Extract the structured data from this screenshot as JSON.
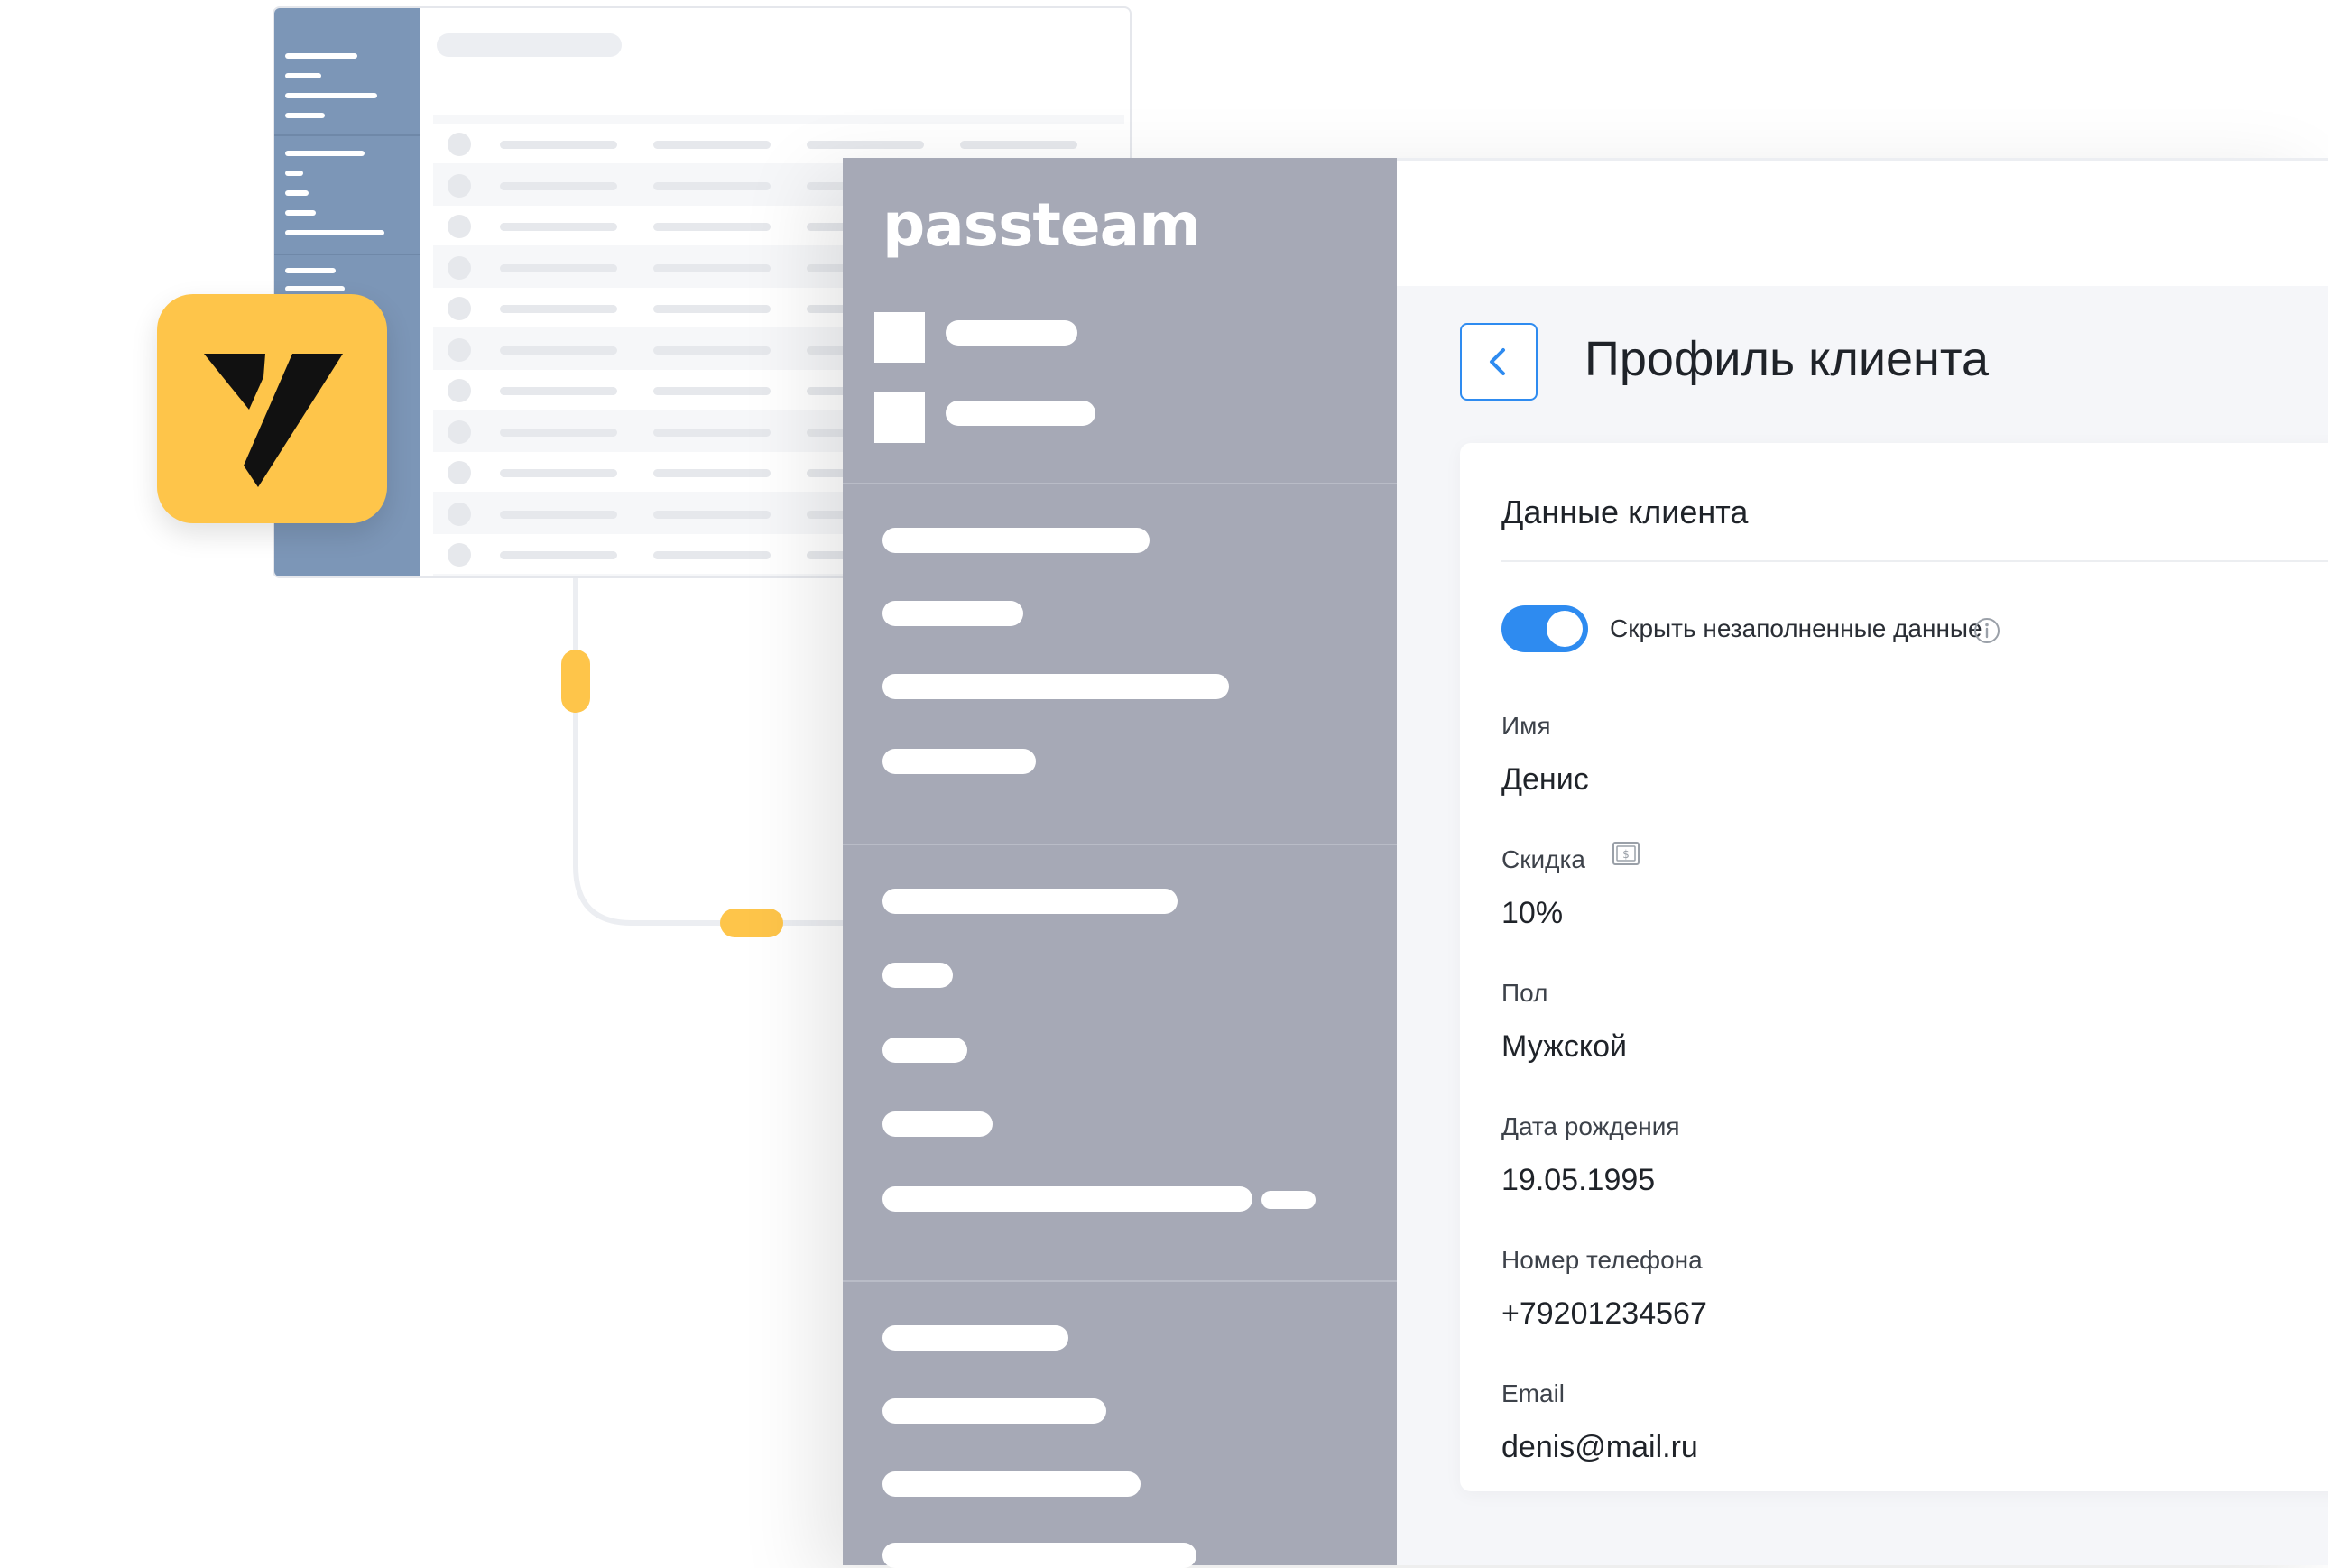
{
  "brand": {
    "name": "passteam",
    "tile_color": "#fec54a"
  },
  "page": {
    "title": "Профиль клиента",
    "back_icon": "chevron-left-icon"
  },
  "card": {
    "title": "Данные клиента",
    "toggle": {
      "label": "Скрыть незаполненные данные",
      "checked": true,
      "info_icon": "info-icon"
    },
    "fields": [
      {
        "label": "Имя",
        "value": "Денис"
      },
      {
        "label": "Скидка",
        "value": "10%",
        "icon": "discount-icon"
      },
      {
        "label": "Пол",
        "value": "Мужской"
      },
      {
        "label": "Дата рождения",
        "value": "19.05.1995"
      },
      {
        "label": "Номер телефона",
        "value": "+79201234567"
      },
      {
        "label": "Email",
        "value": "denis@mail.ru"
      }
    ]
  },
  "colors": {
    "accent": "#2e8bf0",
    "sidebar": "#a6a9b6",
    "bg_window_sidebar": "#7c96b7",
    "connector_marker": "#fec54a"
  }
}
